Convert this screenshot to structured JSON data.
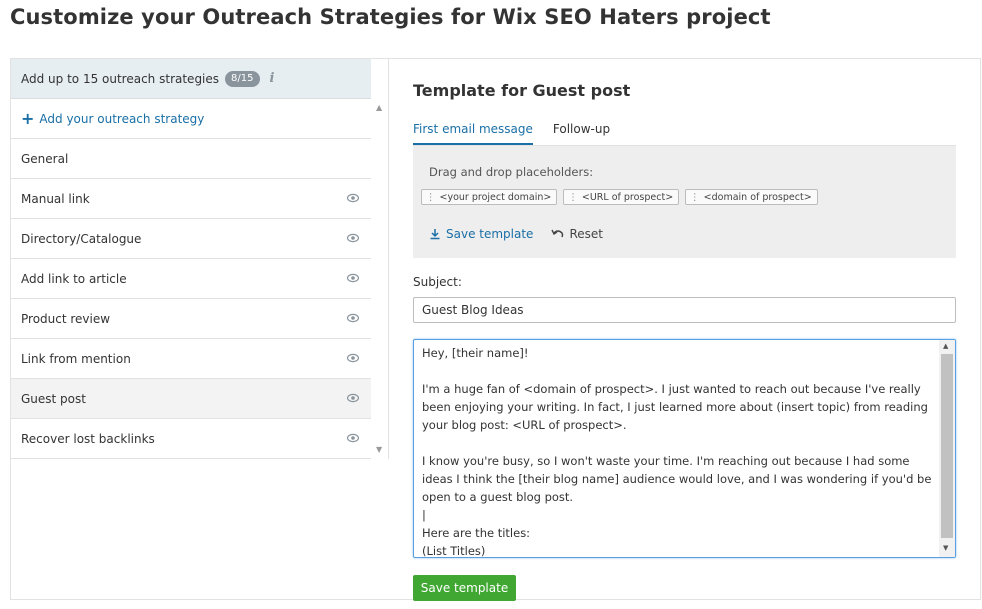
{
  "page": {
    "title": "Customize your Outreach Strategies for Wix SEO Haters project"
  },
  "sidebar": {
    "header": "Add up to 15 outreach strategies",
    "count": "8/15",
    "info_glyph": "i",
    "add_label": "Add your outreach strategy",
    "add_glyph": "+",
    "items": [
      {
        "label": "General"
      },
      {
        "label": "Manual link"
      },
      {
        "label": "Directory/Catalogue"
      },
      {
        "label": "Add link to article"
      },
      {
        "label": "Product review"
      },
      {
        "label": "Link from mention"
      },
      {
        "label": "Guest post"
      },
      {
        "label": "Recover lost backlinks"
      }
    ]
  },
  "editor": {
    "title": "Template for Guest post",
    "tabs": [
      {
        "label": "First email message"
      },
      {
        "label": "Follow-up"
      }
    ],
    "placeholders_label": "Drag and drop placeholders:",
    "placeholders": [
      "<your project domain>",
      "<URL of prospect>",
      "<domain of prospect>"
    ],
    "save_link": "Save template",
    "reset_link": "Reset",
    "subject_label": "Subject:",
    "subject_value": "Guest Blog Ideas",
    "body_lines": [
      "Hey, [their name]!",
      "",
      "I'm a huge fan of <domain of prospect>. I just wanted to reach out because I've really been enjoying your writing. In fact, I just learned more about (insert topic) from reading your blog post: <URL of prospect>.",
      "",
      "I know you're busy, so I won't waste your time. I'm reaching out because I had some ideas I think the [their blog name] audience would love, and I was wondering if you'd be open to a guest blog post.",
      "|",
      "Here are the titles:",
      "(List Titles)"
    ],
    "save_button": "Save template"
  },
  "colors": {
    "accent": "#1a6fa6",
    "save_green": "#40a832",
    "header_bg": "#e6eef2",
    "badge": "#8a949c"
  }
}
